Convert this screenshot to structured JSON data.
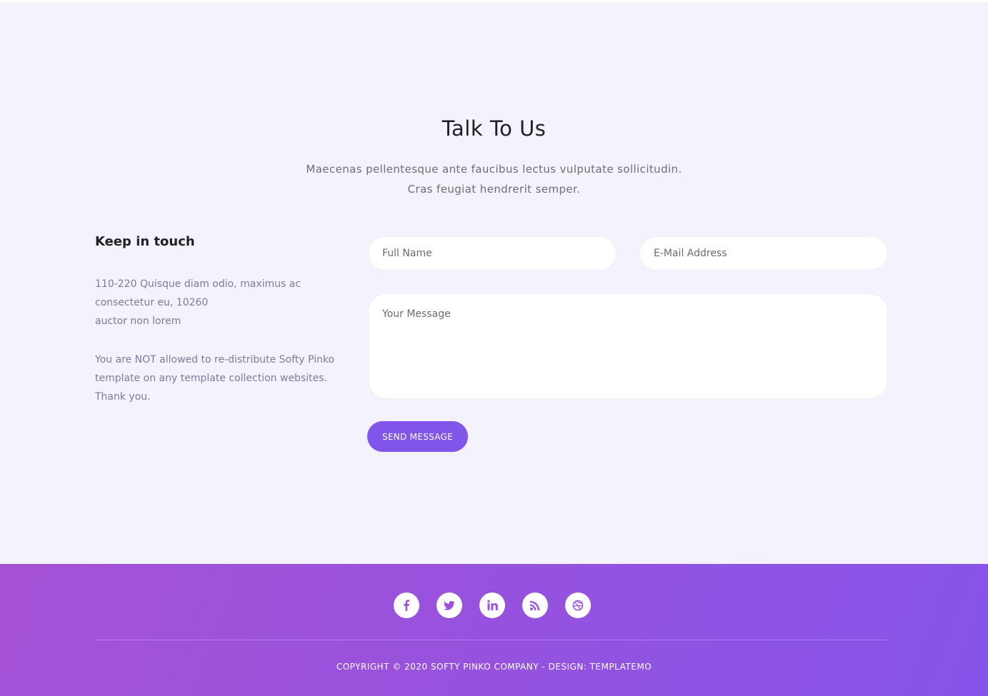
{
  "contact": {
    "title": "Talk To Us",
    "subtitle_line1": "Maecenas pellentesque ante faucibus lectus vulputate sollicitudin.",
    "subtitle_line2": "Cras feugiat hendrerit semper."
  },
  "info": {
    "heading": "Keep in touch",
    "address_line1": "110-220 Quisque diam odio, maximus ac",
    "address_line2": "consectetur eu, 10260",
    "address_line3": "auctor non lorem",
    "notice": "You are NOT allowed to re-distribute Softy Pinko template on any template collection websites. Thank you."
  },
  "form": {
    "name_placeholder": "Full Name",
    "email_placeholder": "E-Mail Address",
    "message_placeholder": "Your Message",
    "submit_label": "SEND MESSAGE"
  },
  "footer": {
    "social_icons": [
      "facebook-icon",
      "twitter-icon",
      "linkedin-icon",
      "rss-icon",
      "dribbble-icon"
    ],
    "copyright": "COPYRIGHT © 2020 SOFTY PINKO COMPANY - DESIGN: TEMPLATEMO"
  },
  "colors": {
    "background": "#f4f3fd",
    "accent": "#8154ea",
    "footer_gradient_start": "#a652d6",
    "footer_gradient_end": "#8654ea",
    "icon_color": "#9b52dc"
  }
}
